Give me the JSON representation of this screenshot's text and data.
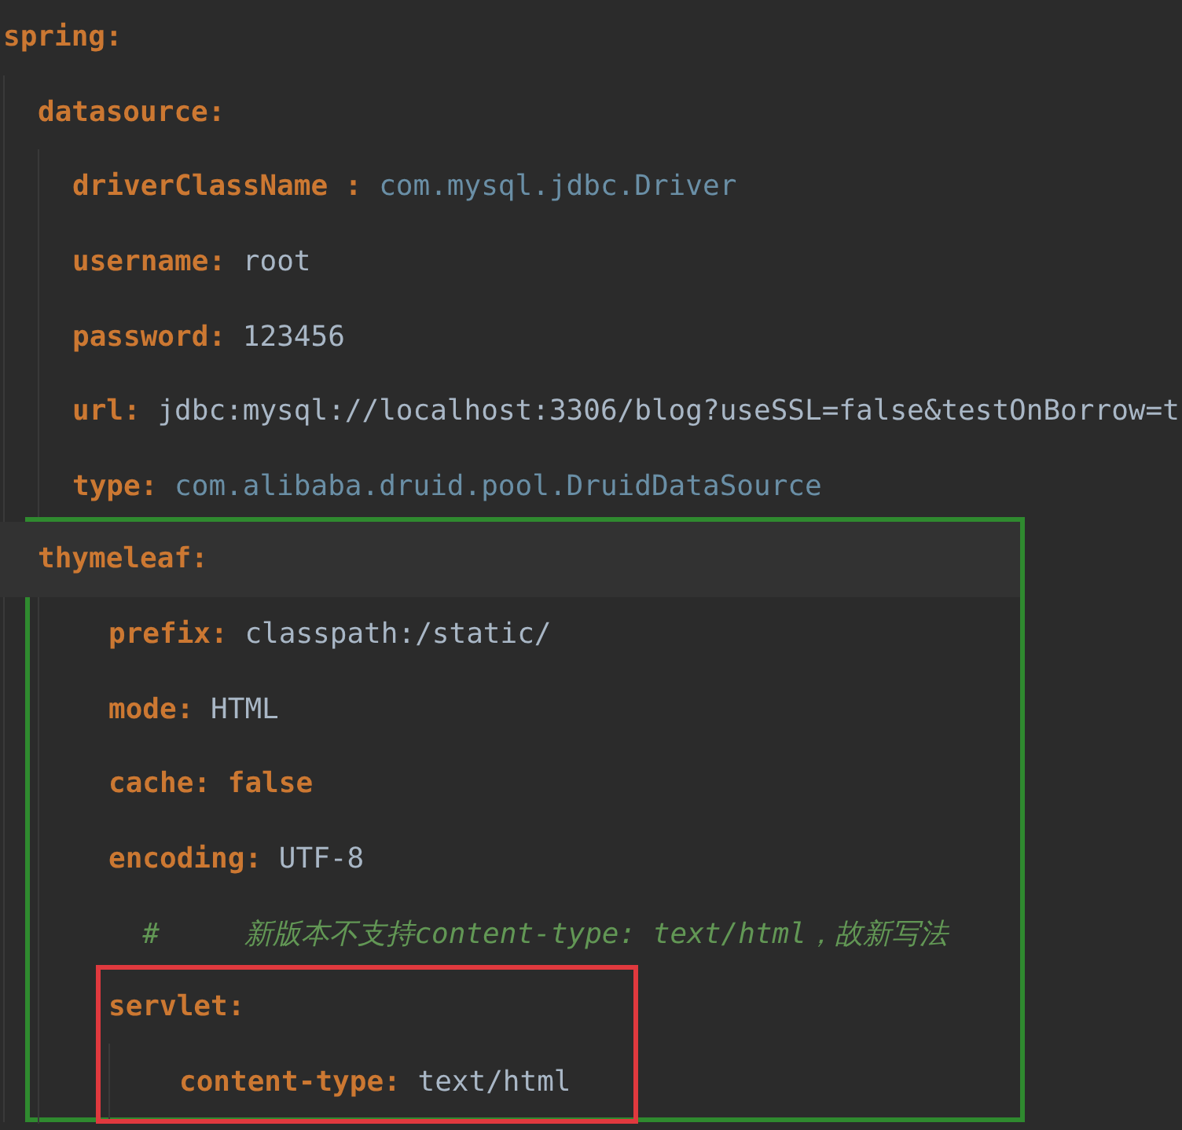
{
  "editor": {
    "lines": [
      {
        "key": "spring:",
        "current": false,
        "children": [
          {
            "key": "datasource:",
            "current": false,
            "children": [
              {
                "key": "driverClassName :",
                "value": "com.mysql.jdbc.Driver",
                "kind": "class",
                "current": false
              },
              {
                "key": "username:",
                "value": "root",
                "kind": "plain",
                "current": false
              },
              {
                "key": "password:",
                "value": "123456",
                "kind": "plain",
                "current": false
              },
              {
                "key": "url:",
                "value": "jdbc:mysql://localhost:3306/blog?useSSL=false&testOnBorrow=t",
                "kind": "plain",
                "current": false
              },
              {
                "key": "type:",
                "value": "com.alibaba.druid.pool.DruidDataSource",
                "kind": "class",
                "current": false
              }
            ]
          },
          {
            "key": "thymeleaf:",
            "current": true,
            "color": "#2f8a2f",
            "children": [
              {
                "key": "prefix:",
                "value": "classpath:/static/",
                "kind": "plain",
                "current": false
              },
              {
                "key": "mode:",
                "value": "HTML",
                "kind": "plain",
                "current": false
              },
              {
                "key": "cache:",
                "value": "false",
                "kind": "keyword",
                "current": false
              },
              {
                "key": "encoding:",
                "value": "UTF-8",
                "kind": "plain",
                "current": false
              },
              {
                "kind": "comment",
                "text": "  #     新版本不支持content-type: text/html，故新写法"
              },
              {
                "key": "servlet:",
                "current": false,
                "color": "#e0393e",
                "children": [
                  {
                    "key": "content-type:",
                    "value": "text/html",
                    "kind": "plain",
                    "current": false
                  }
                ]
              }
            ]
          }
        ]
      }
    ]
  }
}
